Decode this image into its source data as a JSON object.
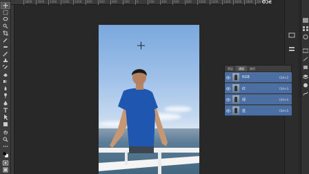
{
  "app": {
    "corner_text": "ƠƆЄ"
  },
  "ruler": {
    "top_ticks": [
      "1800",
      "1600",
      "1400",
      "1200",
      "1000",
      "800",
      "600",
      "400",
      "200",
      "0",
      "200",
      "400",
      "600",
      "800",
      "1000",
      "1200",
      "1400",
      "1600",
      "1800",
      "2000"
    ]
  },
  "toolbar": {
    "tools": [
      "move-icon",
      "marquee-icon",
      "lasso-icon",
      "quick-select-icon",
      "crop-icon",
      "eyedropper-icon",
      "healing-icon",
      "brush-icon",
      "stamp-icon",
      "history-brush-icon",
      "eraser-icon",
      "gradient-icon",
      "blur-icon",
      "dodge-icon",
      "pen-icon",
      "type-icon",
      "path-select-icon",
      "shape-icon",
      "hand-icon",
      "zoom-icon",
      "more-icon",
      "color-swatch-icon",
      "quickmask-icon",
      "screen-mode-icon"
    ]
  },
  "panel": {
    "tabs": [
      "图层",
      "通道",
      "路径"
    ],
    "active_tab": "通道",
    "channels": [
      {
        "name": "RGB",
        "shortcut": "Ctrl+2"
      },
      {
        "name": "红",
        "shortcut": "Ctrl+3"
      },
      {
        "name": "绿",
        "shortcut": "Ctrl+4"
      },
      {
        "name": "蓝",
        "shortcut": "Ctrl+5"
      }
    ]
  },
  "colors": {
    "selected_channel": "#4b6fa3",
    "workspace": "#282828",
    "panel": "#535353"
  }
}
